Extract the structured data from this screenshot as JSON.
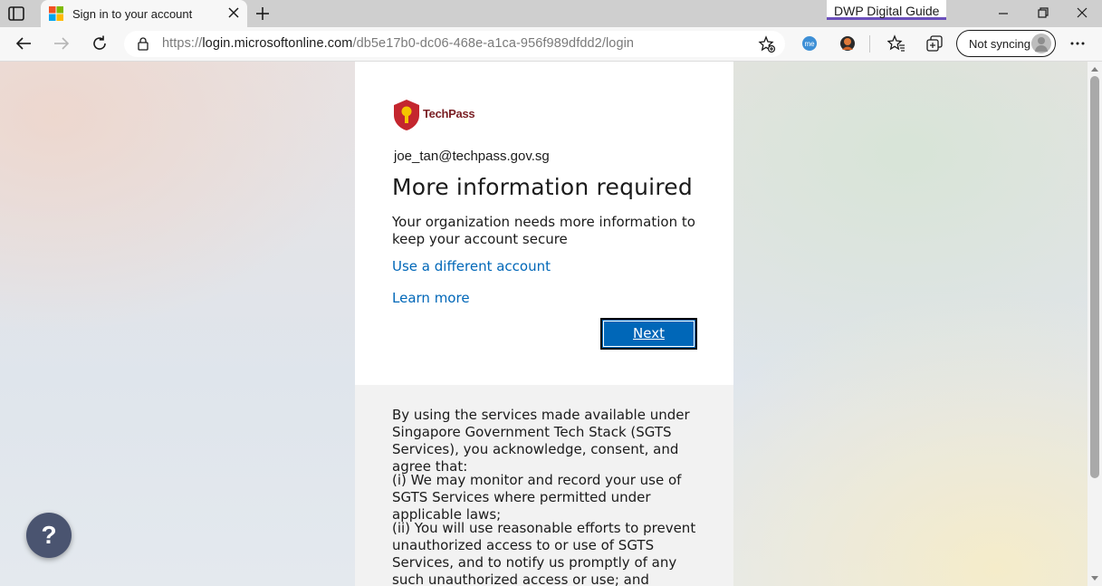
{
  "browser": {
    "tab_title": "Sign in to your account",
    "guide_badge": "DWP Digital Guide",
    "url_prefix": "https://",
    "url_host": "login.microsoftonline.com",
    "url_path": "/db5e17b0-dc06-468e-a1ca-956f989dfdd2/login",
    "sync_label": "Not syncing",
    "extension_me_label": "me"
  },
  "signin": {
    "logo_text": "TechPass",
    "identity": "joe_tan@techpass.gov.sg",
    "heading": "More information required",
    "description": "Your organization needs more information to keep your account secure",
    "link_other_account": "Use a different account",
    "link_learn_more": "Learn more",
    "next_label": "Next"
  },
  "notice": {
    "paragraph_1": "By using the services made available under Singapore Government Tech Stack (SGTS Services), you acknowledge, consent, and agree that:",
    "paragraph_2": "(i) We may monitor and record your use of SGTS Services where permitted under applicable laws;",
    "paragraph_3": "(ii) You will use reasonable efforts to prevent unauthorized access to or use of SGTS Services, and to notify us promptly of any such unauthorized access or use; and"
  },
  "help": {
    "label": "?"
  },
  "colors": {
    "link": "#0067b8",
    "button": "#0067b8",
    "logo_red": "#c4262e",
    "guide_underline": "#6b4fbb"
  }
}
